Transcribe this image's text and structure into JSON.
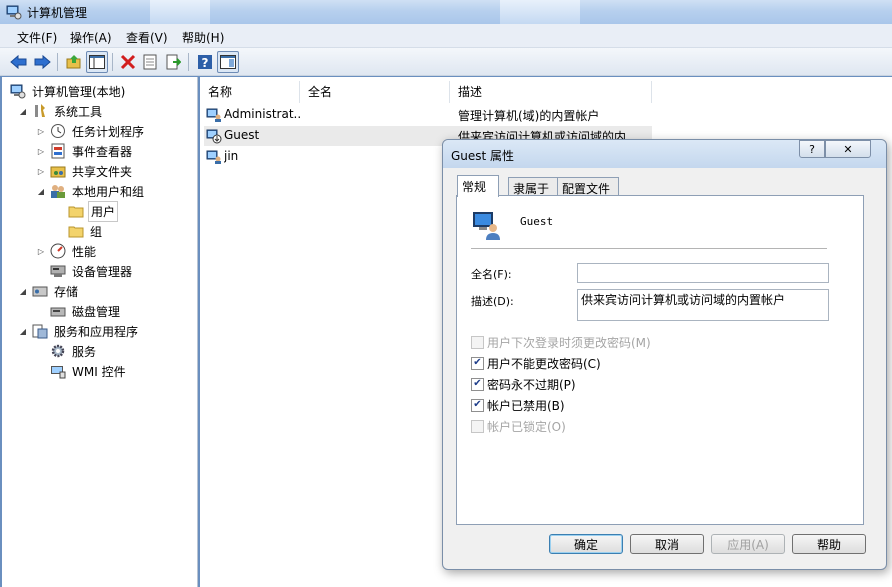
{
  "window": {
    "title": "计算机管理"
  },
  "menu": [
    "文件(F)",
    "操作(A)",
    "查看(V)",
    "帮助(H)"
  ],
  "toolbar": [
    "back-icon",
    "forward-icon",
    "up-icon",
    "show-hide-tree-icon",
    "delete-icon",
    "properties-icon",
    "export-icon",
    "help-icon",
    "action-pane-icon"
  ],
  "tree": [
    {
      "label": "计算机管理(本地)",
      "level": 0,
      "expander": "",
      "icon": "computer-management-icon"
    },
    {
      "label": "系统工具",
      "level": 1,
      "expander": "◢",
      "icon": "tools-icon"
    },
    {
      "label": "任务计划程序",
      "level": 2,
      "expander": "▷",
      "icon": "clock-icon"
    },
    {
      "label": "事件查看器",
      "level": 2,
      "expander": "▷",
      "icon": "event-viewer-icon"
    },
    {
      "label": "共享文件夹",
      "level": 2,
      "expander": "▷",
      "icon": "shared-folder-icon"
    },
    {
      "label": "本地用户和组",
      "level": 2,
      "expander": "◢",
      "icon": "users-groups-icon"
    },
    {
      "label": "用户",
      "level": 3,
      "expander": "",
      "icon": "folder-icon",
      "selected": true
    },
    {
      "label": "组",
      "level": 3,
      "expander": "",
      "icon": "folder-icon"
    },
    {
      "label": "性能",
      "level": 2,
      "expander": "▷",
      "icon": "performance-icon"
    },
    {
      "label": "设备管理器",
      "level": 2,
      "expander": "",
      "icon": "device-manager-icon"
    },
    {
      "label": "存储",
      "level": 1,
      "expander": "◢",
      "icon": "storage-icon"
    },
    {
      "label": "磁盘管理",
      "level": 2,
      "expander": "",
      "icon": "disk-icon"
    },
    {
      "label": "服务和应用程序",
      "level": 1,
      "expander": "◢",
      "icon": "services-apps-icon"
    },
    {
      "label": "服务",
      "level": 2,
      "expander": "",
      "icon": "gear-icon"
    },
    {
      "label": "WMI 控件",
      "level": 2,
      "expander": "",
      "icon": "wmi-icon"
    }
  ],
  "list": {
    "columns": [
      "名称",
      "全名",
      "描述"
    ],
    "rows": [
      {
        "name": "Administrat...",
        "fullname": "",
        "description": "管理计算机(域)的内置帐户",
        "icon": "user-icon"
      },
      {
        "name": "Guest",
        "fullname": "",
        "description": "供来宾访问计算机或访问域的内...",
        "icon": "user-disabled-icon",
        "highlight": true
      },
      {
        "name": "jin",
        "fullname": "",
        "description": "",
        "icon": "user-icon"
      }
    ]
  },
  "dialog": {
    "title": "Guest 属性",
    "help_label": "?",
    "close_label": "✕",
    "tabs": [
      "常规",
      "隶属于",
      "配置文件"
    ],
    "active_tab": 0,
    "username": "Guest",
    "fullname_label": "全名(F):",
    "fullname_value": "",
    "description_label": "描述(D):",
    "description_value": "供来宾访问计算机或访问域的内置帐户",
    "checkboxes": [
      {
        "label": "用户下次登录时须更改密码(M)",
        "checked": false,
        "disabled": true
      },
      {
        "label": "用户不能更改密码(C)",
        "checked": true,
        "disabled": false
      },
      {
        "label": "密码永不过期(P)",
        "checked": true,
        "disabled": false
      },
      {
        "label": "帐户已禁用(B)",
        "checked": true,
        "disabled": false
      },
      {
        "label": "帐户已锁定(O)",
        "checked": false,
        "disabled": true
      }
    ],
    "buttons": [
      {
        "label": "确定",
        "disabled": false,
        "default": true
      },
      {
        "label": "取消",
        "disabled": false
      },
      {
        "label": "应用(A)",
        "disabled": true
      },
      {
        "label": "帮助",
        "disabled": false
      }
    ]
  }
}
